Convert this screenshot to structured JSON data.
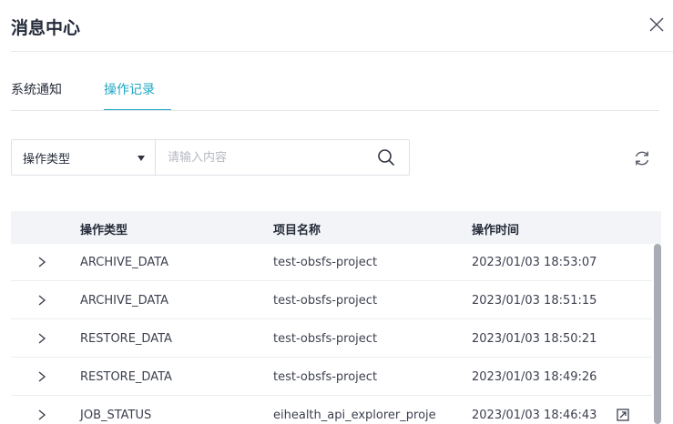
{
  "header": {
    "title": "消息中心"
  },
  "tabs": [
    {
      "label": "系统通知",
      "active": false
    },
    {
      "label": "操作记录",
      "active": true
    }
  ],
  "filter": {
    "select_value": "操作类型",
    "search_placeholder": "请输入内容"
  },
  "table": {
    "columns": [
      "操作类型",
      "项目名称",
      "操作时间"
    ],
    "rows": [
      {
        "type": "ARCHIVE_DATA",
        "project": "test-obsfs-project",
        "time": "2023/01/03 18:53:07"
      },
      {
        "type": "ARCHIVE_DATA",
        "project": "test-obsfs-project",
        "time": "2023/01/03 18:51:15"
      },
      {
        "type": "RESTORE_DATA",
        "project": "test-obsfs-project",
        "time": "2023/01/03 18:50:21"
      },
      {
        "type": "RESTORE_DATA",
        "project": "test-obsfs-project",
        "time": "2023/01/03 18:49:26"
      },
      {
        "type": "JOB_STATUS",
        "project": "eihealth_api_explorer_proje",
        "time": "2023/01/03 18:46:43"
      }
    ]
  },
  "icons": {
    "close": "close-icon",
    "dropdown": "caret-down-icon",
    "search": "search-icon",
    "refresh": "refresh-icon",
    "expand": "chevron-right-icon",
    "open": "external-link-icon"
  },
  "colors": {
    "accent": "#1ea7c4",
    "header_bg": "#f2f4f7",
    "text": "#252b3a"
  }
}
